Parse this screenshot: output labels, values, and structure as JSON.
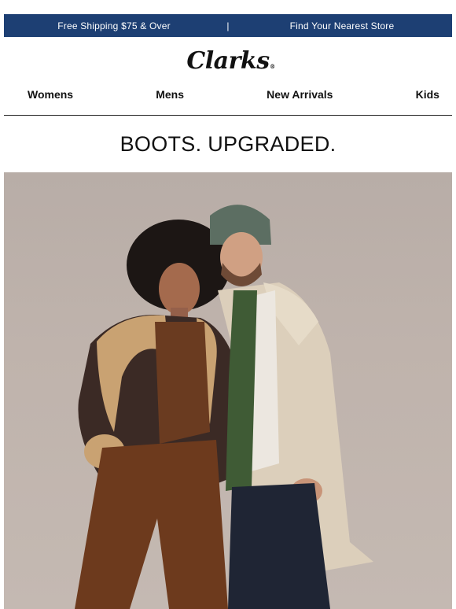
{
  "top_bar": {
    "shipping": "Free Shipping $75 & Over",
    "separator": "|",
    "store": "Find Your Nearest Store",
    "background": "#1d3f73"
  },
  "logo": {
    "text": "Clarks",
    "mark": "®"
  },
  "nav": [
    "Womens",
    "Mens",
    "New Arrivals",
    "Kids"
  ],
  "headline": "BOOTS. UPGRADED.",
  "hero": {
    "icon": "hero-photo-couple-in-winter-coats"
  }
}
